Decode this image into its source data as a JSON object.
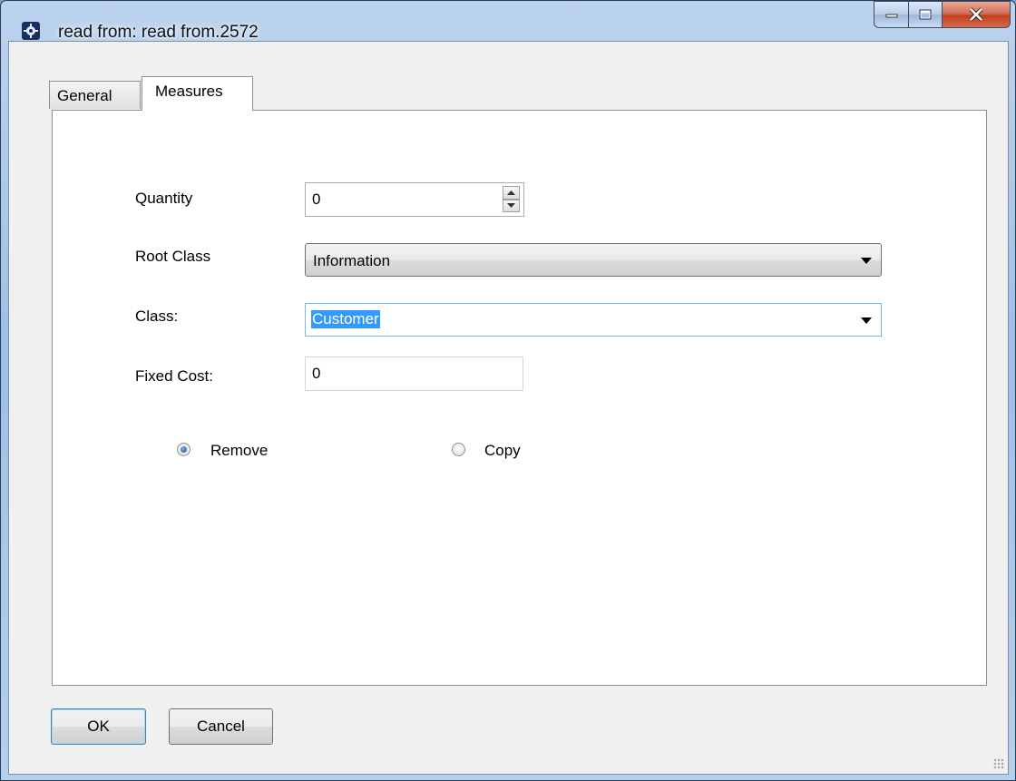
{
  "window": {
    "title": "read from: read from.2572",
    "app_icon": "gear-icon"
  },
  "caption_buttons": {
    "minimize_icon": "minimize-icon",
    "maximize_icon": "maximize-icon",
    "close_icon": "close-icon"
  },
  "tabs": [
    {
      "label": "General",
      "active": false
    },
    {
      "label": "Measures",
      "active": true
    }
  ],
  "form": {
    "quantity": {
      "label": "Quantity",
      "value": "0"
    },
    "root_class": {
      "label": "Root Class",
      "value": "Information"
    },
    "class": {
      "label": "Class:",
      "value": "Customer"
    },
    "fixed_cost": {
      "label": "Fixed Cost:",
      "value": "0"
    }
  },
  "radios": [
    {
      "label": "Remove",
      "checked": true
    },
    {
      "label": "Copy",
      "checked": false
    }
  ],
  "buttons": {
    "ok": "OK",
    "cancel": "Cancel"
  },
  "colors": {
    "selection": "#3399ff",
    "frame": "#9ec0e6",
    "close": "#c23f1f"
  }
}
